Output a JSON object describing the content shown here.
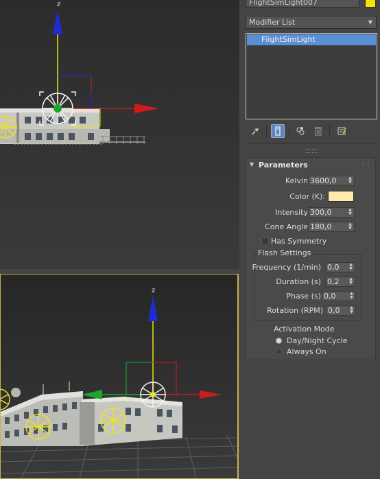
{
  "object": {
    "name": "FlightSimLight007",
    "color": "#f4e600"
  },
  "modifier_list": {
    "label": "Modifier List"
  },
  "stack": {
    "items": [
      "FlightSimLight"
    ]
  },
  "toolbar": {
    "icons": [
      "pin-icon",
      "show-end-result-icon",
      "make-unique-icon",
      "remove-modifier-icon",
      "configure-modifier-sets-icon"
    ]
  },
  "parameters": {
    "title": "Parameters",
    "kelvin_label": "Kelvin",
    "kelvin_value": "3600,0",
    "color_label": "Color (K):",
    "color_value": "#ffecad",
    "intensity_label": "Intensity",
    "intensity_value": "300,0",
    "cone_angle_label": "Cone Angle",
    "cone_angle_value": "180,0",
    "has_symmetry_label": "Has Symmetry",
    "has_symmetry_checked": false
  },
  "flash_settings": {
    "title": "Flash Settings",
    "frequency_label": "Frequency (1/min)",
    "frequency_value": "0,0",
    "duration_label": "Duration (s)",
    "duration_value": "0,2",
    "phase_label": "Phase (s)",
    "phase_value": "0,0",
    "rotation_label": "Rotation (RPM)",
    "rotation_value": "0,0"
  },
  "activation_mode": {
    "title": "Activation Mode",
    "options": [
      "Day/Night Cycle",
      "Always On"
    ],
    "selected": "Day/Night Cycle"
  },
  "viewports": {
    "top": {
      "gizmo_axis_label": "z"
    },
    "bottom": {
      "gizmo_axis_label": "z",
      "active": true
    }
  }
}
